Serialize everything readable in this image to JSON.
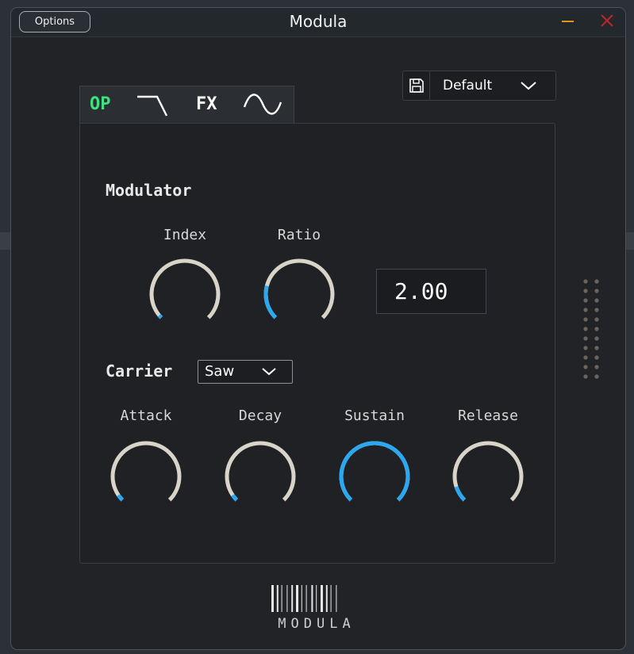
{
  "window": {
    "title": "Modula",
    "options_label": "Options"
  },
  "tabs": [
    {
      "label": "OP",
      "active": true
    },
    {
      "icon": "filter-lowpass-icon"
    },
    {
      "label": "FX"
    },
    {
      "icon": "sine-wave-icon"
    }
  ],
  "preset": {
    "name": "Default",
    "icon": "save-icon"
  },
  "modulator": {
    "heading": "Modulator",
    "index_label": "Index",
    "ratio_label": "Ratio",
    "ratio_value": "2.00",
    "index_level": 0.02,
    "ratio_level": 0.22
  },
  "carrier": {
    "heading": "Carrier",
    "waveform": "Saw",
    "attack_label": "Attack",
    "decay_label": "Decay",
    "sustain_label": "Sustain",
    "release_label": "Release",
    "attack_level": 0.04,
    "decay_level": 0.04,
    "sustain_level": 1.0,
    "release_level": 0.1
  },
  "logo": {
    "text": "MODULA"
  },
  "colors": {
    "accent": "#2aa8f2",
    "knob_track": "#d8d4c8",
    "op_tab": "#3fe07e",
    "minimize": "#d99a1c",
    "close": "#c0262b"
  }
}
